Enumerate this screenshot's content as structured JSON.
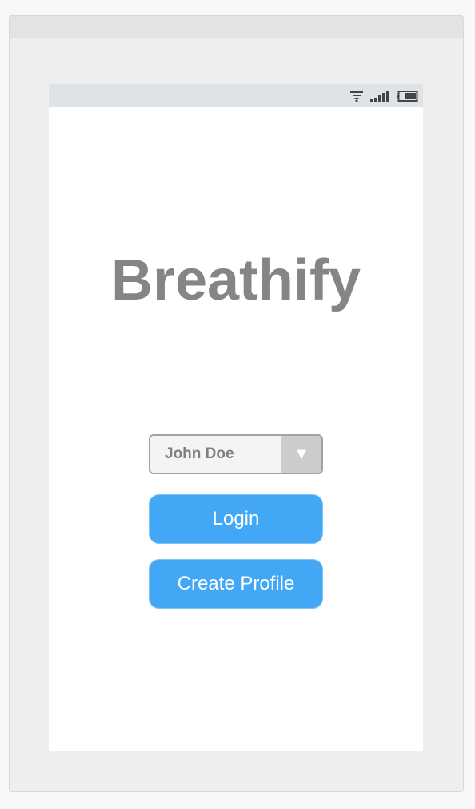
{
  "app": {
    "title": "Breathify"
  },
  "user_select": {
    "value": "John Doe",
    "arrow_icon": "▼"
  },
  "buttons": {
    "login_label": "Login",
    "create_profile_label": "Create Profile"
  },
  "status_bar": {
    "icons": [
      "wifi-icon",
      "signal-icon",
      "battery-icon"
    ]
  },
  "colors": {
    "accent": "#42a8f5",
    "title_gray": "#858585",
    "status_bar_bg": "#dde3e6"
  }
}
